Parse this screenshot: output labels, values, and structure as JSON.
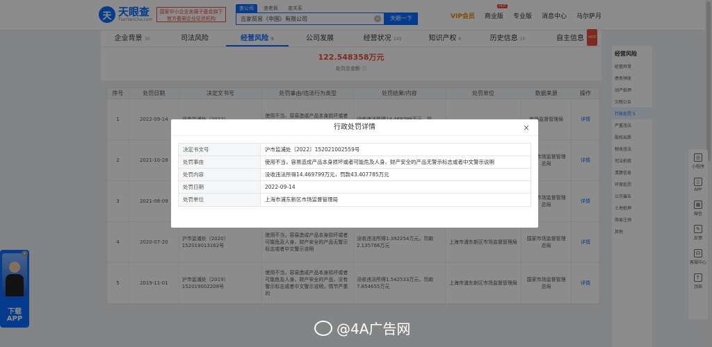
{
  "header": {
    "logo_mark": "天",
    "logo_cn": "天眼查",
    "logo_en": "TianYanCha.com",
    "banner_line1": "国家中小企业发展子基金旗下",
    "banner_line2": "官方备案企业征信机构",
    "search_tabs": [
      "查公司",
      "查老板",
      "查关系"
    ],
    "search_value": "吉家贸易（中国）有限公司",
    "search_button": "天眼一下",
    "nav": {
      "vip": "VIP会员",
      "business": "商业版",
      "pro": "专业版",
      "messages": "消息中心",
      "user": "马尔萨月",
      "hot": "HOT"
    }
  },
  "tabs": [
    {
      "label": "企业背景",
      "count": "30"
    },
    {
      "label": "司法风险",
      "count": ""
    },
    {
      "label": "经营风险",
      "count": "5"
    },
    {
      "label": "公司发展",
      "count": ""
    },
    {
      "label": "经营状况",
      "count": "249"
    },
    {
      "label": "知识产权",
      "count": "6"
    },
    {
      "label": "历史信息",
      "count": "10"
    },
    {
      "label": "自主信息",
      "count": ""
    }
  ],
  "summary": {
    "amount": "122.548358万元",
    "label": "处罚总金额"
  },
  "table": {
    "headers": [
      "序号",
      "处罚日期",
      "决定文书号",
      "处罚事由/违法行为类型",
      "处罚结果/内容",
      "处罚单位",
      "数据来源",
      "操作"
    ],
    "rows": [
      {
        "no": "1",
        "date": "2022-09-14",
        "doc": "沪市监浦处〔2022〕",
        "reason": "使用不当，容易造成产品本身损坏或者可能危及人身、财产安全",
        "result": "没收违法所得14.469799万元，罚",
        "unit": "",
        "source": "市场监督管理局",
        "op": "详情"
      },
      {
        "no": "2",
        "date": "2021-10-28",
        "doc": "",
        "reason": "",
        "result": "",
        "unit": "",
        "source": "国家市场监督管理总局",
        "op": "详情"
      },
      {
        "no": "3",
        "date": "2021-08-09",
        "doc": "",
        "reason": "",
        "result": "",
        "unit": "",
        "source": "国家市场监督管理总局",
        "op": "详情"
      },
      {
        "no": "4",
        "date": "2020-07-20",
        "doc": "沪市监浦处〔2020〕152019013162号",
        "reason": "使用不当，容易造成产品本身损坏或者可能危及人身、财产安全的产品无警示标志或者中文警示说明",
        "result": "没收违法所得1.392254万元，罚款2.135766万元",
        "unit": "上海市浦东新区市场监督管理局",
        "source": "国家市场监督管理总局",
        "op": "详情"
      },
      {
        "no": "5",
        "date": "2019-11-01",
        "doc": "沪市监浦处〔2019〕152019002208号",
        "reason": "使用不当，容易造成产品本身损坏或者可能危及人身、财产安全的产品，没有警示标志或者中文警示说明，情节严重的",
        "result": "没收违法所得1.542533万元，罚款7.854655万元",
        "unit": "上海市浦东新区市场监督管理局",
        "source": "国家市场监督管理总局",
        "op": "详情"
      }
    ]
  },
  "sidebar": {
    "title": "经营风险",
    "items": [
      "经营异常",
      "债务预收",
      "动产抵押",
      "欠税公告",
      "行政处罚",
      "严重违法",
      "股权出质",
      "税收违法",
      "司法拍卖",
      "清算信息",
      "环保处罚",
      "公示催告",
      "土地抵押",
      "简易注销",
      "其他"
    ],
    "active_index": 4,
    "active_count": "5"
  },
  "float_bar": [
    "小程序",
    "APP",
    "微信",
    "反馈",
    "客服中心",
    "顶部"
  ],
  "promo": {
    "line1": "下载",
    "line2": "APP"
  },
  "modal": {
    "title": "行政处罚详情",
    "rows": [
      {
        "label": "决定书文号",
        "value": "沪市监浦处〔2022〕152021002559号"
      },
      {
        "label": "处罚事由",
        "value": "使用不当，容易造成产品本身损坏或者可能危及人身、财产安全的产品无警示标志或者中文警示说明"
      },
      {
        "label": "处罚内容",
        "value": "没收违法所得14.469799万元，罚款43.407785万元"
      },
      {
        "label": "处罚日期",
        "value": "2022-09-14"
      },
      {
        "label": "处罚单位",
        "value": "上海市浦东新区市场监督管理局"
      }
    ]
  },
  "watermark": "@4A广告网"
}
